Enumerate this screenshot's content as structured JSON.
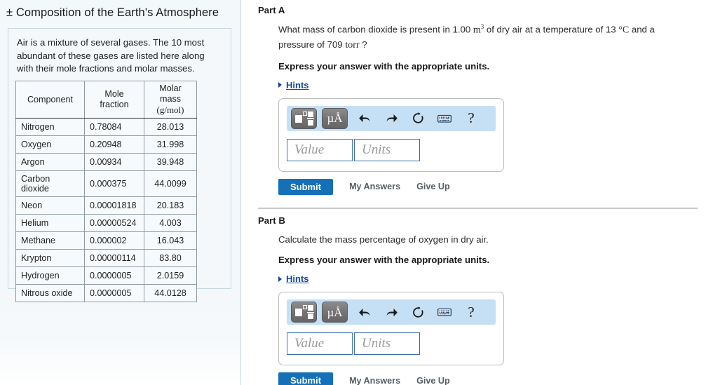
{
  "left": {
    "title": "± Composition of the Earth's Atmosphere",
    "intro": "Air is a mixture of several gases. The 10 most abundant of these gases are listed here along with their mole fractions and molar masses.",
    "table": {
      "headers": [
        "Component",
        "Mole fraction",
        "Molar mass",
        "(g/mol)"
      ],
      "rows": [
        {
          "name": "Nitrogen",
          "fraction": "0.78084",
          "mass": "28.013"
        },
        {
          "name": "Oxygen",
          "fraction": "0.20948",
          "mass": "31.998"
        },
        {
          "name": "Argon",
          "fraction": "0.00934",
          "mass": "39.948"
        },
        {
          "name": "Carbon dioxide",
          "fraction": "0.000375",
          "mass": "44.0099"
        },
        {
          "name": "Neon",
          "fraction": "0.00001818",
          "mass": "20.183"
        },
        {
          "name": "Helium",
          "fraction": "0.00000524",
          "mass": "4.003"
        },
        {
          "name": "Methane",
          "fraction": "0.000002",
          "mass": "16.043"
        },
        {
          "name": "Krypton",
          "fraction": "0.00000114",
          "mass": "83.80"
        },
        {
          "name": "Hydrogen",
          "fraction": "0.0000005",
          "mass": "2.0159"
        },
        {
          "name": "Nitrous oxide",
          "fraction": "0.0000005",
          "mass": "44.0128"
        }
      ]
    }
  },
  "parts": [
    {
      "heading": "Part A",
      "question_pre": "What mass of carbon dioxide is present in 1.00 ",
      "question_unit_volume": "m",
      "question_unit_volume_sup": "3",
      "question_mid": " of dry air at a temperature of 13 ",
      "question_unit_temp": "°C",
      "question_post": " and a pressure of 709 ",
      "question_unit_pressure": "torr",
      "question_end": " ?",
      "express": "Express your answer with the appropriate units.",
      "hints": "Hints"
    },
    {
      "heading": "Part B",
      "question_full": "Calculate the mass percentage of oxygen in dry air.",
      "express": "Express your answer with the appropriate units.",
      "hints": "Hints"
    }
  ],
  "answer_widget": {
    "template_icon": "math-template-icon",
    "units_icon": "µÅ",
    "undo_icon": "undo-arrow-icon",
    "redo_icon": "redo-arrow-icon",
    "reset_icon": "reset-circle-icon",
    "keyboard_icon": "keyboard-icon",
    "help_icon": "?",
    "value_placeholder": "Value",
    "units_placeholder": "Units"
  },
  "actions": {
    "submit": "Submit",
    "my_answers": "My Answers",
    "give_up": "Give Up"
  },
  "colors": {
    "accent_blue": "#1570b8",
    "link_blue": "#12489c",
    "toolbar_blue": "#c5e0f5",
    "panel_bg": "#f3f8fb"
  }
}
